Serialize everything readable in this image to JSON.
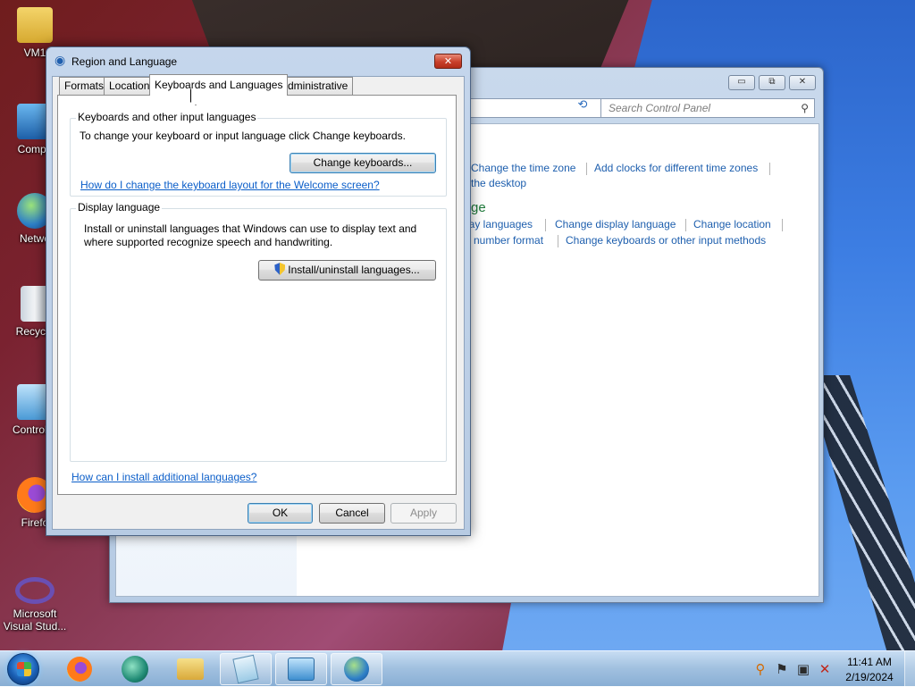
{
  "desktop": {
    "icons": [
      {
        "label": "VM1",
        "icon": "user-folder-icon"
      },
      {
        "label": "Compu",
        "icon": "computer-icon"
      },
      {
        "label": "Netwo",
        "icon": "network-icon"
      },
      {
        "label": "Recycle",
        "icon": "recycle-bin-icon"
      },
      {
        "label": "Control P",
        "icon": "control-panel-icon"
      },
      {
        "label": "Firefo",
        "icon": "firefox-icon"
      },
      {
        "label": "Microsoft Visual Stud...",
        "icon": "visual-studio-icon"
      }
    ]
  },
  "control_panel": {
    "search_placeholder": "Search Control Panel",
    "caption": {
      "minimize": "▭",
      "restore": "⧉",
      "close": "✕"
    },
    "links_row1": [
      "Change the time zone",
      "Add clocks for different time zones"
    ],
    "link_row2": "the desktop",
    "heading_fragment": "ge",
    "links_row3": [
      "lay languages",
      "Change display language",
      "Change location"
    ],
    "links_row4": [
      "number format",
      "Change keyboards or other input methods"
    ]
  },
  "dialog": {
    "title": "Region and Language",
    "close": "✕",
    "tabs": [
      "Formats",
      "Location",
      "Keyboards and Languages",
      "Administrative"
    ],
    "active_tab": "Keyboards and Languages",
    "keyboards_group": {
      "title": "Keyboards and other input languages",
      "description": "To change your keyboard or input language click Change keyboards.",
      "button": "Change keyboards...",
      "link": "How do I change the keyboard layout for the Welcome screen?"
    },
    "display_group": {
      "title": "Display language",
      "description_line1": "Install or uninstall languages that Windows can use to display text and",
      "description_line2": "where supported recognize speech and handwriting.",
      "button": "Install/uninstall languages..."
    },
    "bottom_link": "How can I install additional languages?",
    "buttons": {
      "ok": "OK",
      "cancel": "Cancel",
      "apply": "Apply"
    }
  },
  "taskbar": {
    "pinned": [
      "firefox-icon",
      "browser-icon",
      "file-explorer-icon",
      "notepad-icon",
      "control-panel-icon",
      "region-language-icon"
    ],
    "clock": {
      "time": "11:41 AM",
      "date": "2/19/2024"
    }
  }
}
